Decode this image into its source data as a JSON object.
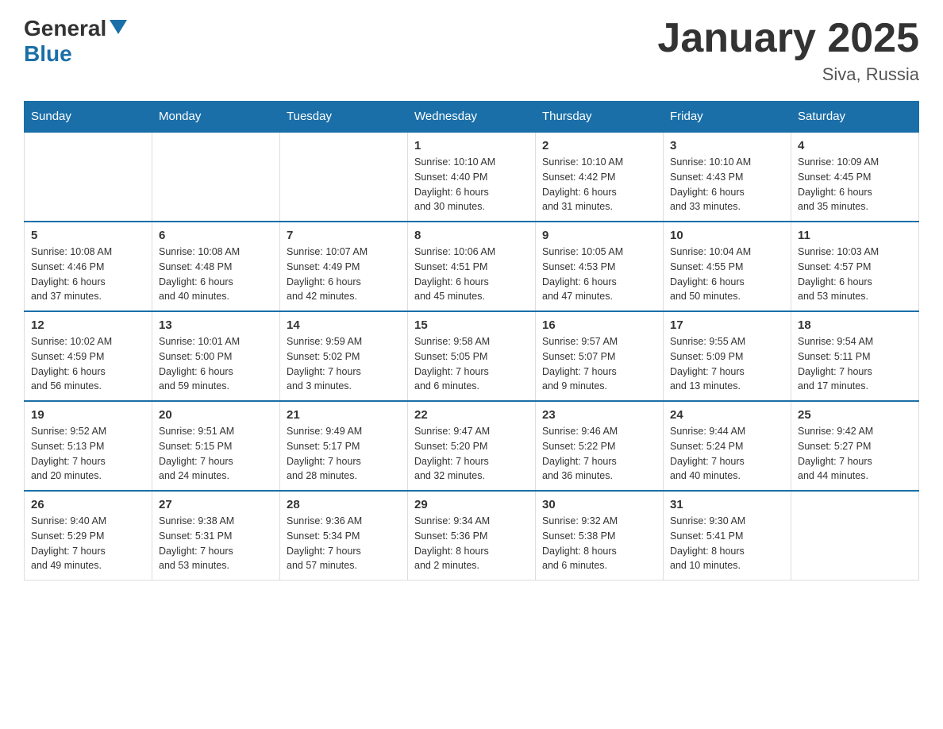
{
  "header": {
    "logo_general": "General",
    "logo_blue": "Blue",
    "title": "January 2025",
    "subtitle": "Siva, Russia"
  },
  "days_of_week": [
    "Sunday",
    "Monday",
    "Tuesday",
    "Wednesday",
    "Thursday",
    "Friday",
    "Saturday"
  ],
  "weeks": [
    [
      {
        "day": "",
        "info": ""
      },
      {
        "day": "",
        "info": ""
      },
      {
        "day": "",
        "info": ""
      },
      {
        "day": "1",
        "info": "Sunrise: 10:10 AM\nSunset: 4:40 PM\nDaylight: 6 hours\nand 30 minutes."
      },
      {
        "day": "2",
        "info": "Sunrise: 10:10 AM\nSunset: 4:42 PM\nDaylight: 6 hours\nand 31 minutes."
      },
      {
        "day": "3",
        "info": "Sunrise: 10:10 AM\nSunset: 4:43 PM\nDaylight: 6 hours\nand 33 minutes."
      },
      {
        "day": "4",
        "info": "Sunrise: 10:09 AM\nSunset: 4:45 PM\nDaylight: 6 hours\nand 35 minutes."
      }
    ],
    [
      {
        "day": "5",
        "info": "Sunrise: 10:08 AM\nSunset: 4:46 PM\nDaylight: 6 hours\nand 37 minutes."
      },
      {
        "day": "6",
        "info": "Sunrise: 10:08 AM\nSunset: 4:48 PM\nDaylight: 6 hours\nand 40 minutes."
      },
      {
        "day": "7",
        "info": "Sunrise: 10:07 AM\nSunset: 4:49 PM\nDaylight: 6 hours\nand 42 minutes."
      },
      {
        "day": "8",
        "info": "Sunrise: 10:06 AM\nSunset: 4:51 PM\nDaylight: 6 hours\nand 45 minutes."
      },
      {
        "day": "9",
        "info": "Sunrise: 10:05 AM\nSunset: 4:53 PM\nDaylight: 6 hours\nand 47 minutes."
      },
      {
        "day": "10",
        "info": "Sunrise: 10:04 AM\nSunset: 4:55 PM\nDaylight: 6 hours\nand 50 minutes."
      },
      {
        "day": "11",
        "info": "Sunrise: 10:03 AM\nSunset: 4:57 PM\nDaylight: 6 hours\nand 53 minutes."
      }
    ],
    [
      {
        "day": "12",
        "info": "Sunrise: 10:02 AM\nSunset: 4:59 PM\nDaylight: 6 hours\nand 56 minutes."
      },
      {
        "day": "13",
        "info": "Sunrise: 10:01 AM\nSunset: 5:00 PM\nDaylight: 6 hours\nand 59 minutes."
      },
      {
        "day": "14",
        "info": "Sunrise: 9:59 AM\nSunset: 5:02 PM\nDaylight: 7 hours\nand 3 minutes."
      },
      {
        "day": "15",
        "info": "Sunrise: 9:58 AM\nSunset: 5:05 PM\nDaylight: 7 hours\nand 6 minutes."
      },
      {
        "day": "16",
        "info": "Sunrise: 9:57 AM\nSunset: 5:07 PM\nDaylight: 7 hours\nand 9 minutes."
      },
      {
        "day": "17",
        "info": "Sunrise: 9:55 AM\nSunset: 5:09 PM\nDaylight: 7 hours\nand 13 minutes."
      },
      {
        "day": "18",
        "info": "Sunrise: 9:54 AM\nSunset: 5:11 PM\nDaylight: 7 hours\nand 17 minutes."
      }
    ],
    [
      {
        "day": "19",
        "info": "Sunrise: 9:52 AM\nSunset: 5:13 PM\nDaylight: 7 hours\nand 20 minutes."
      },
      {
        "day": "20",
        "info": "Sunrise: 9:51 AM\nSunset: 5:15 PM\nDaylight: 7 hours\nand 24 minutes."
      },
      {
        "day": "21",
        "info": "Sunrise: 9:49 AM\nSunset: 5:17 PM\nDaylight: 7 hours\nand 28 minutes."
      },
      {
        "day": "22",
        "info": "Sunrise: 9:47 AM\nSunset: 5:20 PM\nDaylight: 7 hours\nand 32 minutes."
      },
      {
        "day": "23",
        "info": "Sunrise: 9:46 AM\nSunset: 5:22 PM\nDaylight: 7 hours\nand 36 minutes."
      },
      {
        "day": "24",
        "info": "Sunrise: 9:44 AM\nSunset: 5:24 PM\nDaylight: 7 hours\nand 40 minutes."
      },
      {
        "day": "25",
        "info": "Sunrise: 9:42 AM\nSunset: 5:27 PM\nDaylight: 7 hours\nand 44 minutes."
      }
    ],
    [
      {
        "day": "26",
        "info": "Sunrise: 9:40 AM\nSunset: 5:29 PM\nDaylight: 7 hours\nand 49 minutes."
      },
      {
        "day": "27",
        "info": "Sunrise: 9:38 AM\nSunset: 5:31 PM\nDaylight: 7 hours\nand 53 minutes."
      },
      {
        "day": "28",
        "info": "Sunrise: 9:36 AM\nSunset: 5:34 PM\nDaylight: 7 hours\nand 57 minutes."
      },
      {
        "day": "29",
        "info": "Sunrise: 9:34 AM\nSunset: 5:36 PM\nDaylight: 8 hours\nand 2 minutes."
      },
      {
        "day": "30",
        "info": "Sunrise: 9:32 AM\nSunset: 5:38 PM\nDaylight: 8 hours\nand 6 minutes."
      },
      {
        "day": "31",
        "info": "Sunrise: 9:30 AM\nSunset: 5:41 PM\nDaylight: 8 hours\nand 10 minutes."
      },
      {
        "day": "",
        "info": ""
      }
    ]
  ]
}
